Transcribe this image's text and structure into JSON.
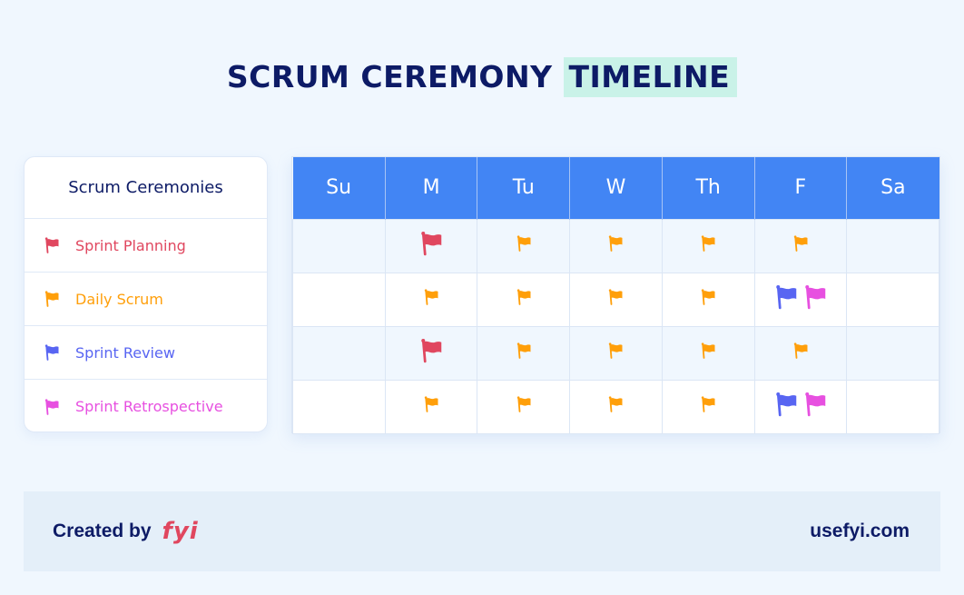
{
  "title": {
    "main": "SCRUM CEREMONY",
    "highlight": "TIMELINE"
  },
  "colors": {
    "sprint_planning": "#e0475f",
    "daily_scrum": "#ff9f0a",
    "sprint_review": "#5865f2",
    "sprint_retrospective": "#e750e0",
    "header_blue": "#4285f4",
    "title_navy": "#0d1b66",
    "highlight_mint": "#c9f2e8"
  },
  "legend": {
    "heading": "Scrum Ceremonies",
    "items": [
      {
        "key": "sprint_planning",
        "label": "Sprint Planning",
        "icon": "flag-icon",
        "color": "#e0475f"
      },
      {
        "key": "daily_scrum",
        "label": "Daily Scrum",
        "icon": "flag-icon",
        "color": "#ff9f0a"
      },
      {
        "key": "sprint_review",
        "label": "Sprint Review",
        "icon": "flag-icon",
        "color": "#5865f2"
      },
      {
        "key": "sprint_retrospective",
        "label": "Sprint Retrospective",
        "icon": "flag-icon",
        "color": "#e750e0"
      }
    ]
  },
  "timeline": {
    "days": [
      "Su",
      "M",
      "Tu",
      "W",
      "Th",
      "F",
      "Sa"
    ],
    "weeks": [
      {
        "row": 1,
        "cells": [
          [],
          [
            {
              "k": "sprint_planning",
              "size": "big"
            }
          ],
          [
            {
              "k": "daily_scrum",
              "size": "small"
            }
          ],
          [
            {
              "k": "daily_scrum",
              "size": "small"
            }
          ],
          [
            {
              "k": "daily_scrum",
              "size": "small"
            }
          ],
          [
            {
              "k": "daily_scrum",
              "size": "small"
            }
          ],
          []
        ]
      },
      {
        "row": 2,
        "cells": [
          [],
          [
            {
              "k": "daily_scrum",
              "size": "small"
            }
          ],
          [
            {
              "k": "daily_scrum",
              "size": "small"
            }
          ],
          [
            {
              "k": "daily_scrum",
              "size": "small"
            }
          ],
          [
            {
              "k": "daily_scrum",
              "size": "small"
            }
          ],
          [
            {
              "k": "sprint_review",
              "size": "big"
            },
            {
              "k": "sprint_retrospective",
              "size": "big"
            }
          ],
          []
        ]
      },
      {
        "row": 3,
        "cells": [
          [],
          [
            {
              "k": "sprint_planning",
              "size": "big"
            }
          ],
          [
            {
              "k": "daily_scrum",
              "size": "small"
            }
          ],
          [
            {
              "k": "daily_scrum",
              "size": "small"
            }
          ],
          [
            {
              "k": "daily_scrum",
              "size": "small"
            }
          ],
          [
            {
              "k": "daily_scrum",
              "size": "small"
            }
          ],
          []
        ]
      },
      {
        "row": 4,
        "cells": [
          [],
          [
            {
              "k": "daily_scrum",
              "size": "small"
            }
          ],
          [
            {
              "k": "daily_scrum",
              "size": "small"
            }
          ],
          [
            {
              "k": "daily_scrum",
              "size": "small"
            }
          ],
          [
            {
              "k": "daily_scrum",
              "size": "small"
            }
          ],
          [
            {
              "k": "sprint_review",
              "size": "big"
            },
            {
              "k": "sprint_retrospective",
              "size": "big"
            }
          ],
          []
        ]
      }
    ]
  },
  "footer": {
    "created_by": "Created by",
    "brand": "fyi",
    "site": "usefyi.com"
  }
}
